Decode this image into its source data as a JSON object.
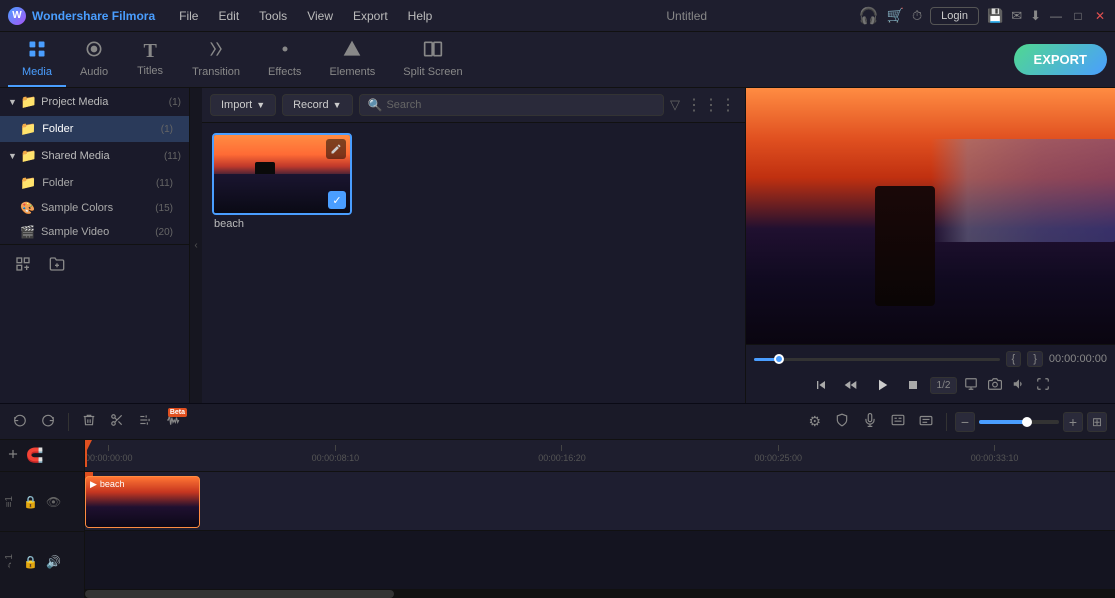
{
  "app": {
    "name": "Wondershare Filmora",
    "title": "Untitled",
    "logo_icon": "🎬"
  },
  "title_bar": {
    "menu_items": [
      "File",
      "Edit",
      "Tools",
      "View",
      "Export",
      "Help"
    ],
    "title": "Untitled",
    "login_label": "Login",
    "icons": {
      "headset": "🎧",
      "cart": "🛒",
      "clock": "⏱",
      "mail": "✉",
      "download": "⬇"
    },
    "window_controls": {
      "minimize": "—",
      "maximize": "□",
      "close": "✕"
    }
  },
  "toolbar": {
    "tabs": [
      {
        "id": "media",
        "label": "Media",
        "icon": "📁",
        "active": true
      },
      {
        "id": "audio",
        "label": "Audio",
        "icon": "🎵",
        "active": false
      },
      {
        "id": "titles",
        "label": "Titles",
        "icon": "T",
        "active": false
      },
      {
        "id": "transition",
        "label": "Transition",
        "icon": "⚡",
        "active": false
      },
      {
        "id": "effects",
        "label": "Effects",
        "icon": "✨",
        "active": false
      },
      {
        "id": "elements",
        "label": "Elements",
        "icon": "🔷",
        "active": false
      },
      {
        "id": "split_screen",
        "label": "Split Screen",
        "icon": "⊞",
        "active": false
      }
    ],
    "export_label": "EXPORT"
  },
  "left_panel": {
    "sections": [
      {
        "id": "project_media",
        "label": "Project Media",
        "count": 1,
        "expanded": true,
        "items": [
          {
            "id": "folder",
            "label": "Folder",
            "count": 1,
            "active": true
          }
        ]
      },
      {
        "id": "shared_media",
        "label": "Shared Media",
        "count": 11,
        "expanded": true,
        "items": [
          {
            "id": "folder2",
            "label": "Folder",
            "count": 11,
            "active": false
          }
        ]
      }
    ],
    "extra_items": [
      {
        "label": "Sample Colors",
        "count": 15
      },
      {
        "label": "Sample Video",
        "count": 20
      }
    ],
    "bottom_buttons": {
      "add_icon": "➕",
      "folder_icon": "📂"
    }
  },
  "media_toolbar": {
    "import_label": "Import",
    "record_label": "Record",
    "search_placeholder": "Search",
    "filter_icon": "▽",
    "grid_icon": "⋮⋮⋮"
  },
  "media_items": [
    {
      "id": "beach",
      "label": "beach",
      "selected": true
    }
  ],
  "preview": {
    "progress": "10%",
    "time_display": "00:00:00:00",
    "left_bracket": "{",
    "right_bracket": "}",
    "controls": {
      "step_back": "⏮",
      "frame_back": "⏪",
      "play": "▶",
      "stop": "⏹",
      "speed": "1/2",
      "screen": "🖥",
      "camera": "📷",
      "volume": "🔊",
      "fullscreen": "⛶"
    }
  },
  "timeline": {
    "toolbar": {
      "undo_icon": "↩",
      "redo_icon": "↪",
      "delete_icon": "🗑",
      "cut_icon": "✂",
      "settings_icon": "⚙",
      "wave_icon": "〰",
      "beta_label": "Beta",
      "right_icons": {
        "settings": "⚙",
        "shield": "🛡",
        "mic": "🎙",
        "caption": "📝",
        "subtitle": "💬",
        "zoom_minus": "−",
        "zoom_plus": "+"
      }
    },
    "ruler": {
      "marks": [
        {
          "time": "00:00:00:00",
          "left_pct": 0
        },
        {
          "time": "00:00:08:10",
          "left_pct": 22
        },
        {
          "time": "00:00:16:20",
          "left_pct": 44
        },
        {
          "time": "00:00:25:00",
          "left_pct": 65
        },
        {
          "time": "00:00:33:10",
          "left_pct": 86
        }
      ]
    },
    "tracks": [
      {
        "id": "track1",
        "num": "1",
        "type": "video",
        "clips": [
          {
            "label": "beach",
            "width": 115
          }
        ]
      },
      {
        "id": "track2",
        "num": "1",
        "type": "audio"
      }
    ],
    "add_track_icon": "➕",
    "magnet_icon": "🧲"
  }
}
